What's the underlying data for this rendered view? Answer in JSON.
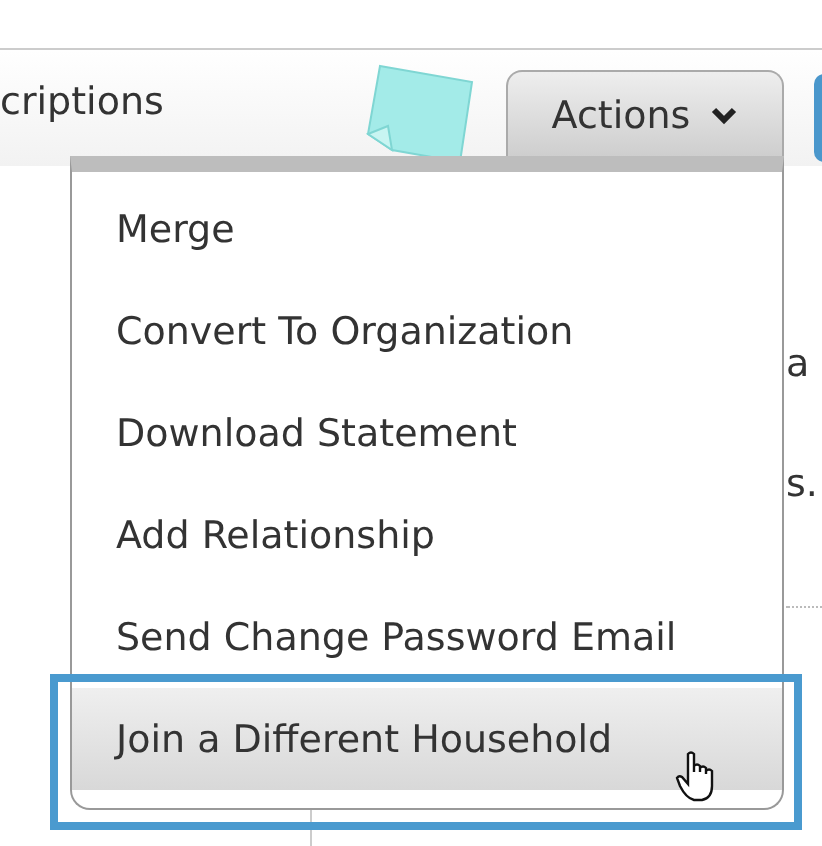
{
  "tabs": [
    {
      "label": "criptions"
    }
  ],
  "actions_button": {
    "label": "Actions",
    "expanded": true
  },
  "background_text": [
    "a",
    "s."
  ],
  "menu": {
    "items": [
      {
        "label": "Merge",
        "highlighted": false
      },
      {
        "label": "Convert To Organization",
        "highlighted": false
      },
      {
        "label": "Download Statement",
        "highlighted": false
      },
      {
        "label": "Add Relationship",
        "highlighted": false
      },
      {
        "label": "Send Change Password Email",
        "highlighted": false
      },
      {
        "label": "Join a Different Household",
        "highlighted": true
      }
    ]
  }
}
